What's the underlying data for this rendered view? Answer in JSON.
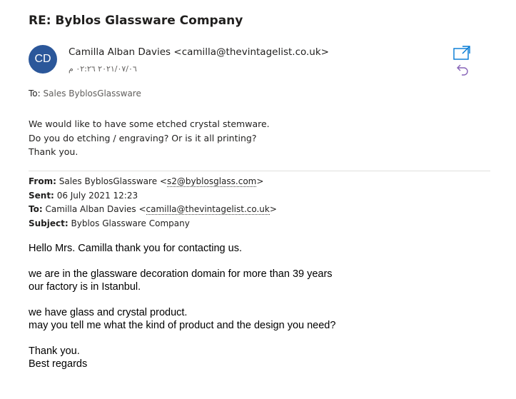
{
  "subject": "RE: Byblos Glassware Company",
  "avatar": {
    "initials": "CD",
    "color": "#2b579a"
  },
  "sender": {
    "display": "Camilla Alban Davies <camilla@thevintagelist.co.uk>"
  },
  "sent_date": "٢٠٢١/٠٧/٠٦ ٠٢:٢٦ م",
  "icons": {
    "popout": "popout-icon",
    "reply": "reply-icon"
  },
  "to": {
    "label": "To:",
    "value": "Sales ByblosGlassware"
  },
  "message": {
    "lines": [
      "We would like to have some etched crystal stemware.",
      "Do you do etching / engraving? Or is it all printing?",
      "Thank you."
    ]
  },
  "quoted": {
    "from_label": "From:",
    "from_name": "Sales ByblosGlassware <",
    "from_email": "s2@byblosglass.com",
    "from_close": ">",
    "sent_label": "Sent:",
    "sent_value": "06 July 2021 12:23",
    "to_label": "To:",
    "to_name": "Camilla Alban Davies <",
    "to_email": "camilla@thevintagelist.co.uk",
    "to_close": ">",
    "subject_label": "Subject:",
    "subject_value": "Byblos Glassware Company"
  },
  "reply": {
    "line1": "Hello Mrs. Camilla thank you for contacting us.",
    "line2": "we are in the glassware decoration domain for more than 39 years",
    "line3": "our factory is in Istanbul.",
    "line4": "we have glass and crystal product.",
    "line5": "may you tell me what the kind of product and the design you need?",
    "line6": "Thank you.",
    "line7": "Best regards"
  }
}
